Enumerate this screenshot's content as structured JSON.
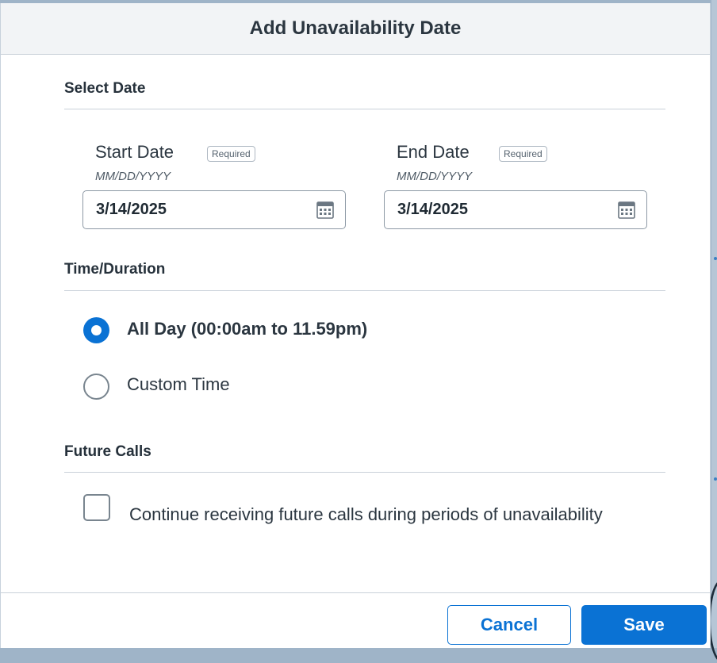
{
  "dialog": {
    "title": "Add Unavailability Date",
    "sections": {
      "select_date": "Select Date",
      "time_duration": "Time/Duration",
      "future_calls": "Future Calls"
    },
    "start_date": {
      "label": "Start Date",
      "badge": "Required",
      "format_hint": "MM/DD/YYYY",
      "value": "3/14/2025",
      "icon": "calendar-icon"
    },
    "end_date": {
      "label": "End Date",
      "badge": "Required",
      "format_hint": "MM/DD/YYYY",
      "value": "3/14/2025",
      "icon": "calendar-icon"
    },
    "duration_options": [
      {
        "label": "All Day (00:00am to 11.59pm)",
        "selected": true
      },
      {
        "label": "Custom Time",
        "selected": false
      }
    ],
    "future_calls_checkbox": {
      "label": "Continue receiving future calls during periods of unavailability",
      "checked": false
    },
    "buttons": {
      "cancel": "Cancel",
      "save": "Save"
    },
    "colors": {
      "accent": "#0a72d4",
      "header_bg": "#f2f4f6",
      "border": "#c9d1d9"
    }
  }
}
